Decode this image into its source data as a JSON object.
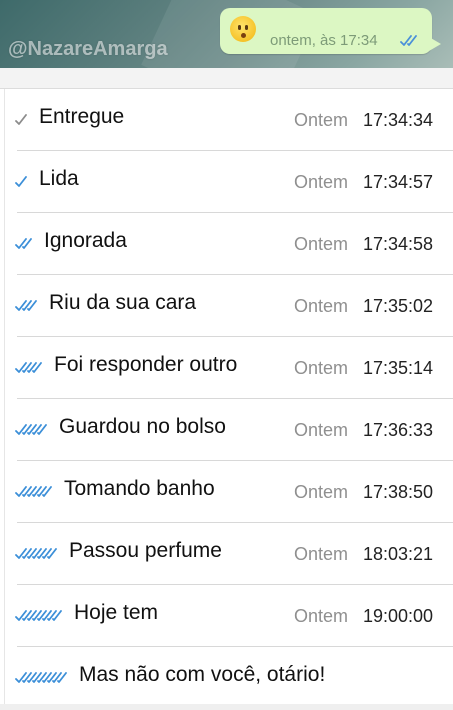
{
  "header": {
    "watermark": "@NazareAmarga",
    "bubble_time": "ontem, às 17:34",
    "bubble_tick_color": "#4a90d9",
    "emoji_icon": "hushed-face-emoji"
  },
  "colors": {
    "tick_grey": "#8c8c8c",
    "tick_blue": "#3c8fd8",
    "bubble_bg": "#dcf7c3"
  },
  "rows": [
    {
      "ticks": 1,
      "color": "grey",
      "label": "Entregue",
      "day": "Ontem",
      "time": "17:34:34"
    },
    {
      "ticks": 1,
      "color": "blue",
      "label": "Lida",
      "day": "Ontem",
      "time": "17:34:57"
    },
    {
      "ticks": 2,
      "color": "blue",
      "label": "Ignorada",
      "day": "Ontem",
      "time": "17:34:58"
    },
    {
      "ticks": 3,
      "color": "blue",
      "label": "Riu da sua cara",
      "day": "Ontem",
      "time": "17:35:02"
    },
    {
      "ticks": 4,
      "color": "blue",
      "label": "Foi responder outro",
      "day": "Ontem",
      "time": "17:35:14"
    },
    {
      "ticks": 5,
      "color": "blue",
      "label": "Guardou no bolso",
      "day": "Ontem",
      "time": "17:36:33"
    },
    {
      "ticks": 6,
      "color": "blue",
      "label": "Tomando banho",
      "day": "Ontem",
      "time": "17:38:50"
    },
    {
      "ticks": 7,
      "color": "blue",
      "label": "Passou perfume",
      "day": "Ontem",
      "time": "18:03:21"
    },
    {
      "ticks": 8,
      "color": "blue",
      "label": "Hoje tem",
      "day": "Ontem",
      "time": "19:00:00"
    },
    {
      "ticks": 9,
      "color": "blue",
      "label": "Mas não com você, otário!",
      "day": "",
      "time": ""
    }
  ]
}
